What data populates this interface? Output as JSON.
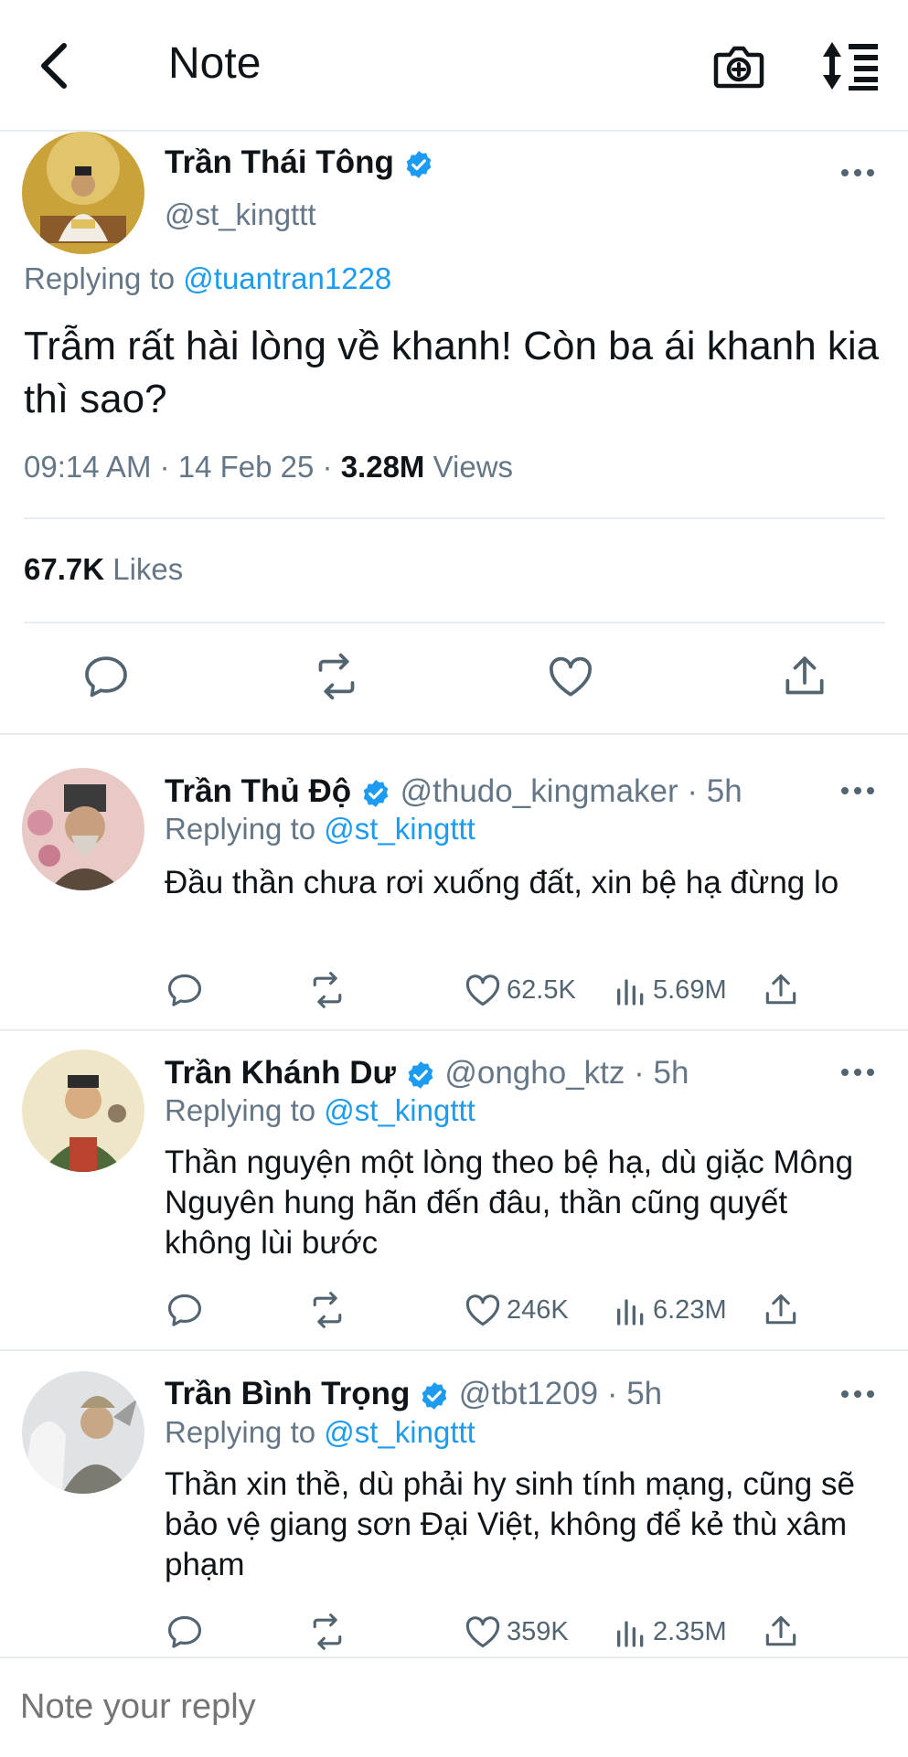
{
  "header": {
    "title": "Note"
  },
  "main_tweet": {
    "name": "Trần Thái Tông",
    "handle": "@st_kingttt",
    "replying_label": "Replying to",
    "replying_to": "@tuantran1228",
    "text": "Trẫm rất hài lòng về khanh! Còn ba ái khanh kia thì sao?",
    "time": "09:14 AM · 14 Feb 25 · ",
    "views_count": "3.28M",
    "views_label": " Views",
    "likes_count": "67.7K",
    "likes_label": " Likes"
  },
  "replies": [
    {
      "name": "Trần Thủ Độ",
      "handle": "@thudo_kingmaker · 5h",
      "replying_label": "Replying to",
      "replying_to": "@st_kingttt",
      "text": "Đầu thần chưa rơi xuống đất, xin bệ hạ đừng lo",
      "likes": "62.5K",
      "views": "5.69M"
    },
    {
      "name": "Trần Khánh Dư",
      "handle": "@ongho_ktz · 5h",
      "replying_label": "Replying to",
      "replying_to": "@st_kingttt",
      "text": "Thần nguyện một lòng theo bệ hạ, dù giặc Mông Nguyên hung hãn đến đâu, thần cũng quyết không lùi bước",
      "likes": "246K",
      "views": "6.23M"
    },
    {
      "name": "Trần Bình Trọng",
      "handle": "@tbt1209 · 5h",
      "replying_label": "Replying to",
      "replying_to": "@st_kingttt",
      "text": "Thần xin thề, dù phải hy sinh tính mạng, cũng sẽ bảo vệ giang sơn Đại Việt, không để kẻ thù xâm phạm",
      "likes": "359K",
      "views": "2.35M"
    }
  ],
  "composer": {
    "placeholder": "Note your reply"
  },
  "colors": {
    "accent": "#1d9bf0",
    "muted": "#657786",
    "divider": "#e6ecf0"
  }
}
